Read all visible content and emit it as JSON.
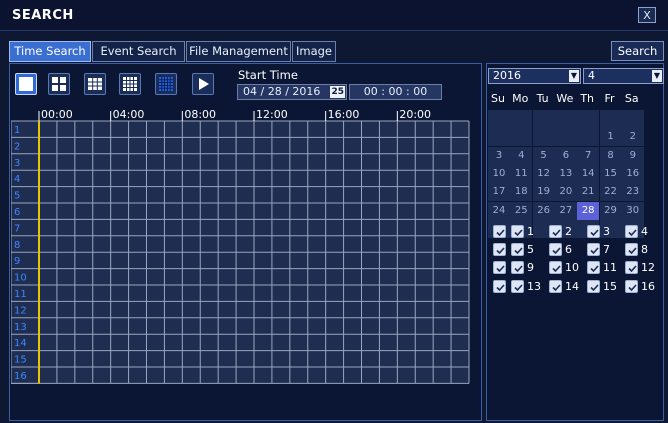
{
  "window": {
    "title": "SEARCH",
    "close_label": "X"
  },
  "tabs": [
    {
      "label": "Time Search",
      "active": true
    },
    {
      "label": "Event Search",
      "active": false
    },
    {
      "label": "File Management",
      "active": false
    },
    {
      "label": "Image",
      "active": false
    }
  ],
  "search_button": "Search",
  "toolbar": {
    "buttons": [
      {
        "name": "split-1-button",
        "icon": "single-view-icon",
        "selected": true
      },
      {
        "name": "split-4-button",
        "icon": "quad-view-icon",
        "selected": false
      },
      {
        "name": "split-9-button",
        "icon": "nine-view-icon",
        "selected": false
      },
      {
        "name": "split-16-button",
        "icon": "sixteen-view-icon",
        "selected": false
      },
      {
        "name": "split-all-button",
        "icon": "grid-view-icon",
        "selected": false
      },
      {
        "name": "play-button",
        "icon": "play-icon",
        "selected": false
      }
    ]
  },
  "start_time": {
    "label": "Start Time",
    "date_value": "04 / 28 / 2016",
    "date_selected_part": "25",
    "time_value": "00 : 00 : 00"
  },
  "timeline": {
    "hour_labels": [
      "00:00",
      "04:00",
      "08:00",
      "12:00",
      "16:00",
      "20:00"
    ],
    "channels": [
      "1",
      "2",
      "3",
      "4",
      "5",
      "6",
      "7",
      "8",
      "9",
      "10",
      "11",
      "12",
      "13",
      "14",
      "15",
      "16"
    ]
  },
  "calendar": {
    "year": "2016",
    "month": "4",
    "weekdays": [
      "Su",
      "Mo",
      "Tu",
      "We",
      "Th",
      "Fr",
      "Sa"
    ],
    "weeks": [
      [
        "",
        "",
        "",
        "",
        "",
        "",
        ""
      ],
      [
        "",
        "",
        "",
        "",
        "",
        "1",
        "2"
      ],
      [
        "3",
        "4",
        "5",
        "6",
        "7",
        "8",
        "9"
      ],
      [
        "10",
        "11",
        "12",
        "13",
        "14",
        "15",
        "16"
      ],
      [
        "17",
        "18",
        "19",
        "20",
        "21",
        "22",
        "23"
      ],
      [
        "24",
        "25",
        "26",
        "27",
        "28",
        "29",
        "30"
      ],
      [
        "",
        "",
        "",
        "",
        "",
        "",
        ""
      ]
    ],
    "selected_day": "28"
  },
  "channel_checks": {
    "all_checked": true,
    "rows": [
      [
        "1",
        "2",
        "3",
        "4"
      ],
      [
        "5",
        "6",
        "7",
        "8"
      ],
      [
        "9",
        "10",
        "11",
        "12"
      ],
      [
        "13",
        "14",
        "15",
        "16"
      ]
    ]
  },
  "colors": {
    "accent": "#3a6fd1",
    "selected_day": "#5b62d8",
    "timeline_marker": "#e8c500",
    "grid_line": "#9aa6bf",
    "panel_border": "#3a5fa5"
  }
}
